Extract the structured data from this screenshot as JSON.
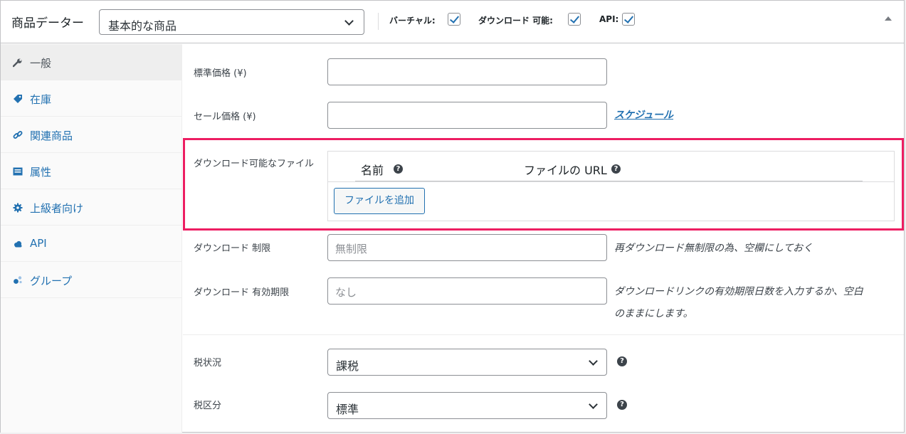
{
  "header": {
    "title": "商品データー",
    "product_type": "基本的な商品",
    "virtual_label": "バーチャル:",
    "downloadable_label": "ダウンロード 可能:",
    "api_label": "API:"
  },
  "sidebar": {
    "items": [
      {
        "label": "一般",
        "icon": "wrench-icon",
        "active": true
      },
      {
        "label": "在庫",
        "icon": "tag-icon"
      },
      {
        "label": "関連商品",
        "icon": "link-icon"
      },
      {
        "label": "属性",
        "icon": "list-icon"
      },
      {
        "label": "上級者向け",
        "icon": "gear-icon"
      },
      {
        "label": "API",
        "icon": "cloud-icon"
      },
      {
        "label": "グループ",
        "icon": "group-icon"
      }
    ]
  },
  "fields": {
    "regular_price_label": "標準価格 (¥)",
    "sale_price_label": "セール価格 (¥)",
    "schedule_link": "スケジュール",
    "downloadable_files_label": "ダウンロード可能なファイル",
    "files_col_name": "名前",
    "files_col_url": "ファイルの URL",
    "add_file_button": "ファイルを追加",
    "download_limit_label": "ダウンロード 制限",
    "download_limit_placeholder": "無制限",
    "download_limit_desc": "再ダウンロード無制限の為、空欄にしておく",
    "download_expiry_label": "ダウンロード 有効期限",
    "download_expiry_placeholder": "なし",
    "download_expiry_desc_1": "ダウンロードリンクの有効期限日数を入力するか、空白",
    "download_expiry_desc_2": "のままにします。",
    "tax_status_label": "税状況",
    "tax_status_value": "課税",
    "tax_class_label": "税区分",
    "tax_class_value": "標準"
  },
  "colors": {
    "accent": "#2271b1",
    "highlight": "#ed1e62"
  }
}
